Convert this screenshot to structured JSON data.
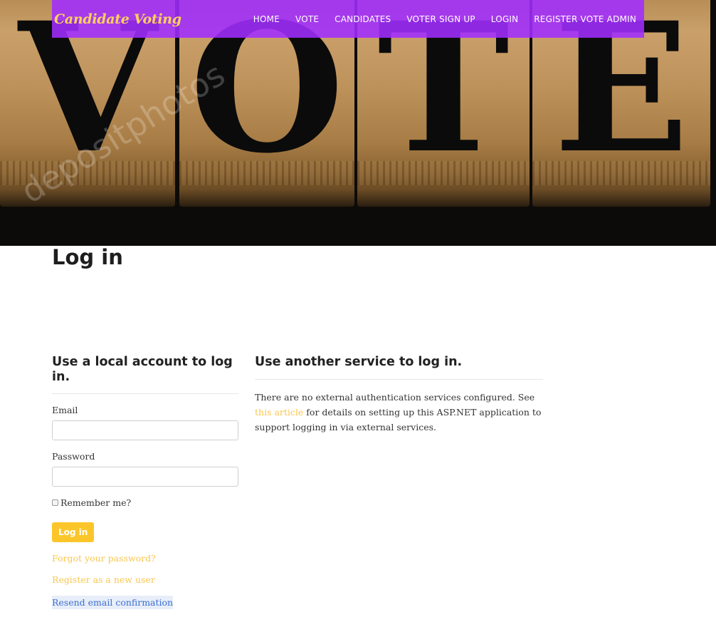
{
  "nav": {
    "brand": "Candidate Voting",
    "items": [
      "HOME",
      "VOTE",
      "CANDIDATES",
      "VOTER SIGN UP",
      "LOGIN",
      "REGISTER VOTE ADMIN"
    ]
  },
  "hero": {
    "letters": [
      "V",
      "O",
      "T",
      "E"
    ],
    "watermark": "depositphotos"
  },
  "page": {
    "title": "Log in"
  },
  "local": {
    "heading": "Use a local account to log in.",
    "email_label": "Email",
    "email_value": "",
    "password_label": "Password",
    "password_value": "",
    "remember_label": "Remember me?",
    "submit_label": "Log in",
    "forgot_link": "Forgot your password?",
    "register_link": "Register as a new user",
    "resend_link": "Resend email confirmation"
  },
  "external": {
    "heading": "Use another service to log in.",
    "text_before": "There are no external authentication services configured. See ",
    "link_text": "this article",
    "text_after": " for details on setting up this ASP.NET application to support logging in via external services."
  },
  "colors": {
    "nav_bg": "#a02cff",
    "brand": "#ffd15c",
    "button": "#fcc62b",
    "link": "#f9c74f",
    "link_active": "#3b6fd3"
  }
}
